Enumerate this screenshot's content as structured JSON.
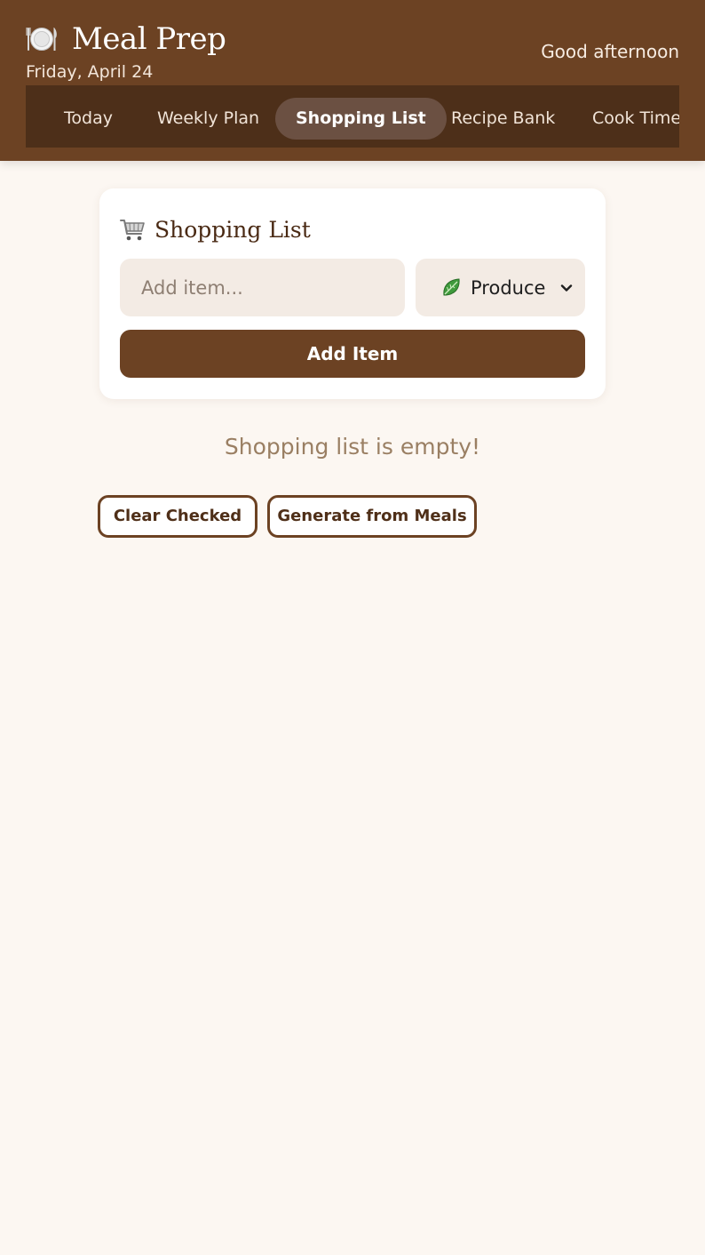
{
  "header": {
    "title": "Meal Prep",
    "date": "Friday, April 24",
    "greeting": "Good afternoon",
    "icon": "plate-cutlery-icon"
  },
  "nav": {
    "tabs": [
      {
        "label": "Today",
        "active": false
      },
      {
        "label": "Weekly Plan",
        "active": false
      },
      {
        "label": "Shopping List",
        "active": true
      },
      {
        "label": "Recipe Bank",
        "active": false
      },
      {
        "label": "Cook Timer",
        "active": false
      }
    ]
  },
  "shopping": {
    "title": "Shopping List",
    "title_icon": "shopping-cart-icon",
    "input_placeholder": "Add item...",
    "input_value": "",
    "category": {
      "selected": "Produce",
      "icon": "leafy-green-icon"
    },
    "add_label": "Add Item",
    "empty_message": "Shopping list is empty!",
    "clear_checked_label": "Clear Checked",
    "generate_label": "Generate from Meals"
  },
  "colors": {
    "brand_brown": "#6c4223",
    "nav_bg": "#4d2f19",
    "nav_active": "#6b5042",
    "page_bg": "#fcf7f2",
    "muted_text": "#9a7f63"
  }
}
